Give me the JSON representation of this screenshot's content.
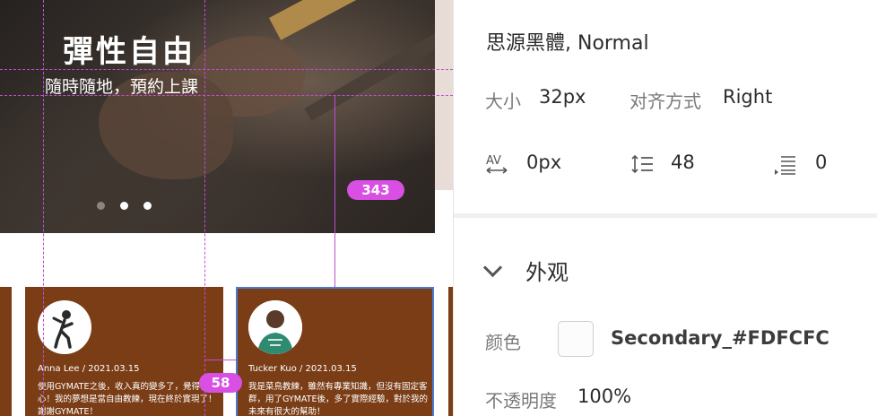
{
  "hero": {
    "title": "彈性自由",
    "subtitle": "隨時隨地，預約上課",
    "dots": [
      {
        "active": false
      },
      {
        "active": true
      },
      {
        "active": true
      }
    ]
  },
  "measurements": {
    "top": "343",
    "bottom": "58"
  },
  "cards": [
    {
      "meta": "Anna Lee / 2021.03.15",
      "text": "使用GYMATE之後，收入真的變多了，覺得很開心！我的夢想是當自由教練，現在終於實現了！謝謝GYMATE！"
    },
    {
      "meta": "Tucker Kuo / 2021.03.15",
      "text": "我是菜鳥教練，雖然有專業知識，但沒有固定客群，用了GYMATE後，多了實際經驗，對於我的未來有很大的幫助！"
    }
  ],
  "panel": {
    "font": "思源黑體, Normal",
    "size_label": "大小",
    "size_value": "32px",
    "align_label": "对齐方式",
    "align_value": "Right",
    "tracking_value": "0px",
    "line_height_value": "48",
    "paragraph_value": "0",
    "appearance_title": "外观",
    "color_label": "颜色",
    "color_value": "Secondary_#FDFCFC",
    "swatch_color": "#fdfcfc",
    "opacity_label": "不透明度",
    "opacity_value": "100%"
  }
}
